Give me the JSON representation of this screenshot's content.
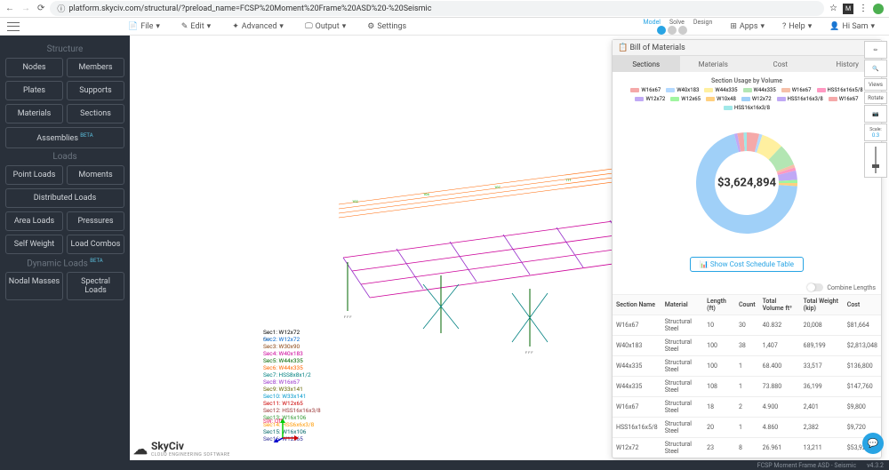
{
  "browser": {
    "url": "platform.skyciv.com/structural/?preload_name=FCSP%20Moment%20Frame%20ASD%20-%20Seismic"
  },
  "toolbar": {
    "file": "File",
    "edit": "Edit",
    "advanced": "Advanced",
    "output": "Output",
    "settings": "Settings",
    "modes": [
      "Model",
      "Solve",
      "Design"
    ],
    "apps": "Apps",
    "help": "Help",
    "user": "Hi Sam"
  },
  "sidebar": {
    "structure_title": "Structure",
    "structure": [
      [
        "Nodes",
        "Members"
      ],
      [
        "Plates",
        "Supports"
      ],
      [
        "Materials",
        "Sections"
      ]
    ],
    "assemblies": "Assemblies",
    "beta": "BETA",
    "loads_title": "Loads",
    "loads": [
      [
        "Point Loads",
        "Moments"
      ]
    ],
    "dist_loads": "Distributed Loads",
    "loads2": [
      [
        "Area Loads",
        "Pressures"
      ],
      [
        "Self Weight",
        "Load Combos"
      ]
    ],
    "dyn_title": "Dynamic Loads",
    "dyn": [
      [
        "Nodal Masses",
        "Spectral Loads"
      ]
    ]
  },
  "panel": {
    "title": "Bill of Materials",
    "tabs": [
      "Sections",
      "Materials",
      "Cost",
      "History"
    ],
    "chart_title": "Section Usage by Volume",
    "center": "$3,624,894",
    "cost_btn": "Show Cost Schedule Table",
    "combine": "Combine Lengths"
  },
  "chart_data": {
    "type": "pie",
    "title": "Section Usage by Volume",
    "series": [
      {
        "name": "W16x67",
        "value": 4,
        "color": "#f5a9a9"
      },
      {
        "name": "W40x183",
        "value": 1,
        "color": "#b3d9ff"
      },
      {
        "name": "W44x335",
        "value": 7,
        "color": "#fff0a0"
      },
      {
        "name": "W44x335",
        "value": 7,
        "color": "#b3e6b3"
      },
      {
        "name": "W16x67",
        "value": 1,
        "color": "#f5c0a9"
      },
      {
        "name": "HSS16x16x5/8",
        "value": 1,
        "color": "#ff99c2"
      },
      {
        "name": "W12x72",
        "value": 3,
        "color": "#c0a9f5"
      },
      {
        "name": "W12x65",
        "value": 1,
        "color": "#a0f5a0"
      },
      {
        "name": "W10x48",
        "value": 1,
        "color": "#ffd080"
      },
      {
        "name": "W12x72",
        "value": 70,
        "color": "#a0d0f8"
      },
      {
        "name": "HSS16x16x3/8",
        "value": 1,
        "color": "#c0a9f5"
      },
      {
        "name": "W16x67",
        "value": 2,
        "color": "#f5a9a9"
      },
      {
        "name": "HSS16x16x3/8",
        "value": 1,
        "color": "#a0e8e8"
      }
    ]
  },
  "table": {
    "headers": [
      "Section Name",
      "Material",
      "Length (ft)",
      "Count",
      "Total Volume ft³",
      "Total Weight (kip)",
      "Cost"
    ],
    "rows": [
      [
        "W16x67",
        "Structural Steel",
        "10",
        "30",
        "40.832",
        "20,008",
        "$81,664"
      ],
      [
        "W40x183",
        "Structural Steel",
        "100",
        "38",
        "1,407",
        "689,199",
        "$2,813,048"
      ],
      [
        "W44x335",
        "Structural Steel",
        "100",
        "1",
        "68.400",
        "33,517",
        "$136,800"
      ],
      [
        "W44x335",
        "Structural Steel",
        "108",
        "1",
        "73.880",
        "36,199",
        "$147,760"
      ],
      [
        "W16x67",
        "Structural Steel",
        "18",
        "2",
        "4.900",
        "2,401",
        "$9,800"
      ],
      [
        "HSS16x16x5/8",
        "Structural Steel",
        "20",
        "1",
        "4.860",
        "2,382",
        "$9,720"
      ],
      [
        "W12x72",
        "Structural Steel",
        "23",
        "8",
        "26.961",
        "13,211",
        "$53,922"
      ]
    ]
  },
  "sections_legend": [
    {
      "t": "Sec1: W12x72",
      "c": "#000"
    },
    {
      "t": "Sec2: W12x72",
      "c": "#0066cc"
    },
    {
      "t": "Sec3: W30x90",
      "c": "#8B4513"
    },
    {
      "t": "Sec4: W40x183",
      "c": "#cc0099"
    },
    {
      "t": "Sec5: W44x335",
      "c": "#006600"
    },
    {
      "t": "Sec6: W44x335",
      "c": "#ff6600"
    },
    {
      "t": "Sec7: HSS8x8x1/2",
      "c": "#008080"
    },
    {
      "t": "Sec8: W16x67",
      "c": "#9933cc"
    },
    {
      "t": "Sec9: W33x141",
      "c": "#666600"
    },
    {
      "t": "Sec10: W33x141",
      "c": "#0099cc"
    },
    {
      "t": "Sec11: W12x65",
      "c": "#cc0000"
    },
    {
      "t": "Sec12: HSS16x16x3/8",
      "c": "#993333"
    },
    {
      "t": "Sec13: W16x106",
      "c": "#339933"
    },
    {
      "t": "Sec14: HSS6x6x3/8",
      "c": "#ff9900"
    },
    {
      "t": "Sec15: W16x106",
      "c": "#006666"
    },
    {
      "t": "Sec16: W12x65",
      "c": "#333399"
    }
  ],
  "sw_off": "SW: Off",
  "tools": [
    "✏",
    "🔍",
    "Views",
    "Rotate",
    "📷",
    "Scale:",
    "0.3"
  ],
  "footer": {
    "name": "FCSP Moment Frame ASD - Seismic",
    "ver": "v4.3.2"
  },
  "logo": {
    "name": "SkyCiv",
    "sub": "CLOUD ENGINEERING SOFTWARE"
  }
}
